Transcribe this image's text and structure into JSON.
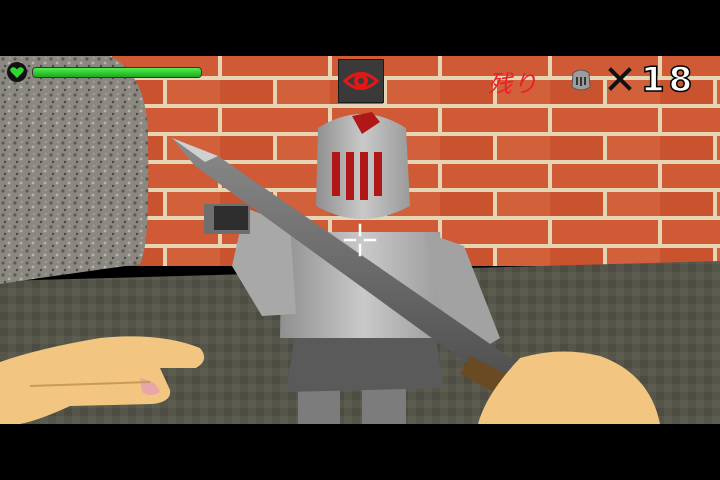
{
  "hud": {
    "health": {
      "fraction": 1.0,
      "color": "#2fd82f",
      "icon": "heart-icon"
    },
    "indicator": {
      "icon": "eye-icon",
      "color": "#e01818"
    },
    "remaining": {
      "label": "残り",
      "enemy_icon": "knight-head-icon",
      "multiply_icon": "times-icon",
      "count": "18"
    }
  },
  "colors": {
    "brick": "#cf5a35",
    "mortar": "#e9d7b8",
    "floor": "#525247",
    "armor": "#bdbdbd",
    "visor_slit": "#b01818",
    "skin": "#f2c680"
  }
}
